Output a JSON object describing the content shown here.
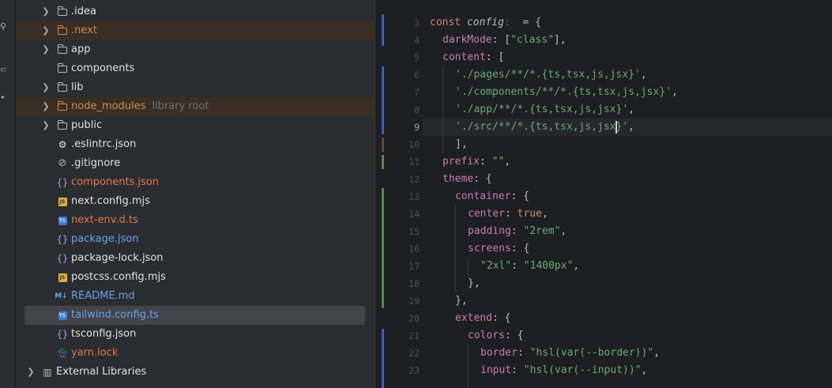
{
  "colors": {
    "tree_bg": "#2b2d30",
    "editor_bg": "#1e1f22",
    "excluded_bg": "#3a2f25",
    "selected_bg": "#43454a",
    "orange": "#d08c54",
    "blue": "#6aa3f0",
    "string": "#6aab73",
    "property": "#c77dbb",
    "keyword": "#cf8e6d"
  },
  "tree": {
    "items": [
      {
        "label": ".idea",
        "icon": "folder-icon"
      },
      {
        "label": ".next",
        "icon": "folder-icon"
      },
      {
        "label": "app",
        "icon": "folder-icon"
      },
      {
        "label": "components",
        "icon": "folder-icon"
      },
      {
        "label": "lib",
        "icon": "folder-icon"
      },
      {
        "label": "node_modules",
        "hint": "library root",
        "icon": "folder-icon"
      },
      {
        "label": "public",
        "icon": "folder-icon"
      },
      {
        "label": ".eslintrc.json",
        "icon": "eslint-icon"
      },
      {
        "label": ".gitignore",
        "icon": "gitignore-icon"
      },
      {
        "label": "components.json",
        "icon": "json-icon",
        "glyph": "{}"
      },
      {
        "label": "next.config.mjs",
        "icon": "js-file-icon",
        "glyph": "JS"
      },
      {
        "label": "next-env.d.ts",
        "icon": "ts-file-icon",
        "glyph": "TS"
      },
      {
        "label": "package.json",
        "icon": "json-icon",
        "glyph": "{}"
      },
      {
        "label": "package-lock.json",
        "icon": "json-icon",
        "glyph": "{}"
      },
      {
        "label": "postcss.config.mjs",
        "icon": "js-file-icon",
        "glyph": "JS"
      },
      {
        "label": "README.md",
        "icon": "markdown-icon",
        "glyph": "M↓"
      },
      {
        "label": "tailwind.config.ts",
        "icon": "ts-file-icon",
        "glyph": "TS"
      },
      {
        "label": "tsconfig.json",
        "icon": "json-icon",
        "glyph": "{}"
      },
      {
        "label": "yarn.lock",
        "icon": "yarn-icon"
      },
      {
        "label": "External Libraries",
        "icon": "libraries-icon"
      }
    ]
  },
  "editor": {
    "current_line": "9",
    "line_numbers": [
      "3",
      "4",
      "5",
      "6",
      "7",
      "8",
      "9",
      "10",
      "11",
      "12",
      "13",
      "14",
      "15",
      "16",
      "17",
      "18",
      "19",
      "20",
      "21",
      "22",
      "23"
    ],
    "code": {
      "l3": {
        "kw": "const",
        "name": "config",
        "colon": ":",
        "rest": "  = {"
      },
      "l4": {
        "prop": "darkMode",
        "p1": ": [",
        "str": "\"class\"",
        "p2": "],"
      },
      "l5": {
        "prop": "content",
        "p1": ": ["
      },
      "l6": {
        "str": "'./pages/**/*.{ts,tsx,js,jsx}'",
        "p": ","
      },
      "l7": {
        "str": "'./components/**/*.{ts,tsx,js,jsx}'",
        "p": ","
      },
      "l8": {
        "str": "'./app/**/*.{ts,tsx,js,jsx}'",
        "p": ","
      },
      "l9": {
        "str_a": "'./src/**/*.{ts,tsx,js,jsx",
        "str_b": "}'",
        "p": ","
      },
      "l10": {
        "p": "],"
      },
      "l11": {
        "prop": "prefix",
        "p1": ": ",
        "str": "\"\"",
        "p2": ","
      },
      "l12": {
        "prop": "theme",
        "p1": ": {"
      },
      "l13": {
        "prop": "container",
        "p1": ": {"
      },
      "l14": {
        "prop": "center",
        "p1": ": ",
        "kwv": "true",
        "p2": ","
      },
      "l15": {
        "prop": "padding",
        "p1": ": ",
        "str": "\"2rem\"",
        "p2": ","
      },
      "l16": {
        "prop": "screens",
        "p1": ": {"
      },
      "l17": {
        "str1": "\"2xl\"",
        "p1": ": ",
        "str2": "\"1400px\"",
        "p2": ","
      },
      "l18": {
        "p": "},"
      },
      "l19": {
        "p": "},"
      },
      "l20": {
        "prop": "extend",
        "p1": ": {"
      },
      "l21": {
        "prop": "colors",
        "p1": ": {"
      },
      "l22": {
        "prop": "border",
        "p1": ": ",
        "str": "\"hsl(var(--border))\"",
        "p2": ","
      },
      "l23": {
        "prop": "input",
        "p1": ": ",
        "str": "\"hsl(var(--input))\"",
        "p2": ","
      }
    }
  }
}
